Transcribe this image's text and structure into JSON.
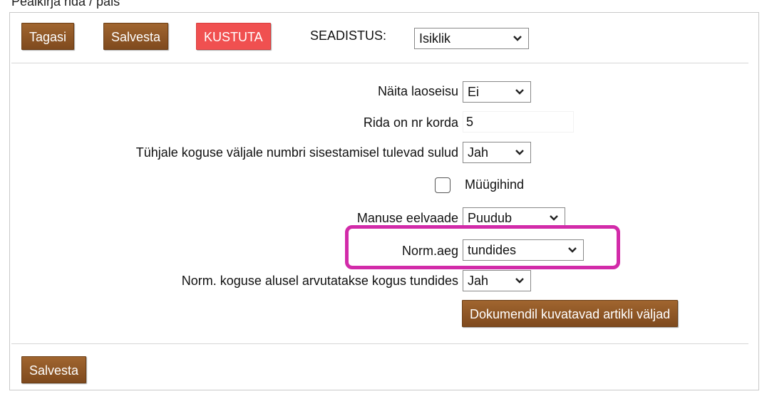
{
  "caption": "Pealkirja rida / päis",
  "toolbar": {
    "back_label": "Tagasi",
    "save_label": "Salvesta",
    "delete_label": "KUSTUTA",
    "settings_label": "SEADISTUS:",
    "settings_value": "Isiklik"
  },
  "form": {
    "show_stock": {
      "label": "Näita laoseisu",
      "value": "Ei"
    },
    "row_count": {
      "label": "Rida on nr korda",
      "value": "5"
    },
    "brackets": {
      "label": "Tühjale koguse väljale numbri sisestamisel tulevad sulud",
      "value": "Jah"
    },
    "sale_price": {
      "label": "Müügihind",
      "checked": false
    },
    "attachment_preview": {
      "label": "Manuse eelvaade",
      "value": "Puudub"
    },
    "norm_time": {
      "label": "Norm.aeg",
      "value": "tundides"
    },
    "norm_qty": {
      "label": "Norm. koguse alusel arvutatakse kogus tundides",
      "value": "Jah"
    },
    "fields_button": "Dokumendil kuvatavad artikli väljad"
  },
  "footer": {
    "save_label": "Salvesta"
  },
  "colors": {
    "button": "#8b5526",
    "danger": "#f05050",
    "highlight": "#d22ba9"
  }
}
